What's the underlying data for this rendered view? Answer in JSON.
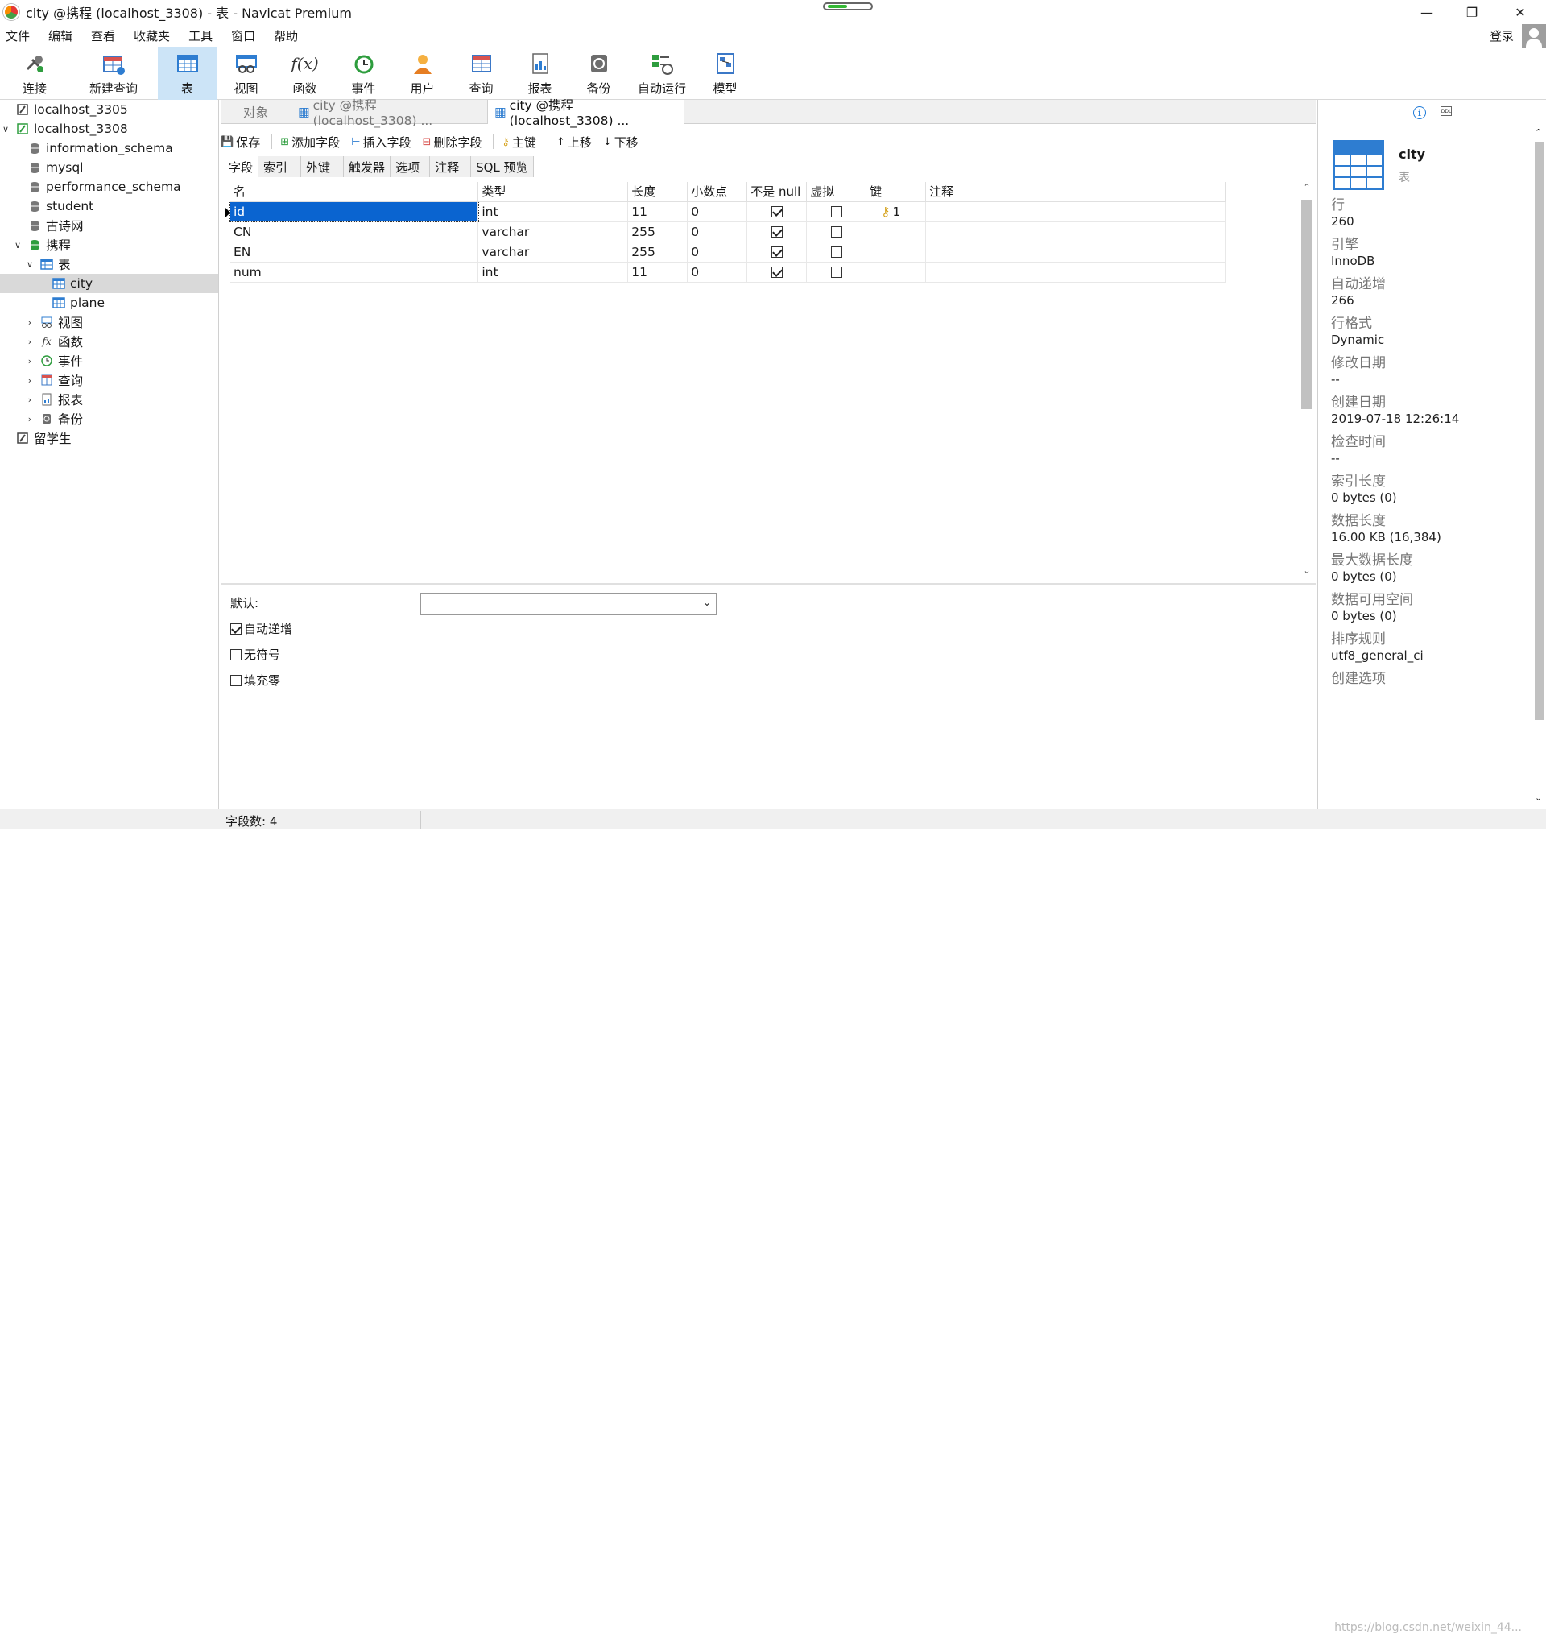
{
  "window": {
    "title": "city @携程 (localhost_3308) - 表 - Navicat Premium"
  },
  "menu": [
    "文件",
    "编辑",
    "查看",
    "收藏夹",
    "工具",
    "窗口",
    "帮助"
  ],
  "login_label": "登录",
  "toolbar": [
    {
      "label": "连接",
      "icon": "connect-icon"
    },
    {
      "label": "新建查询",
      "icon": "new-query-icon"
    },
    {
      "label": "表",
      "icon": "table-icon",
      "active": true
    },
    {
      "label": "视图",
      "icon": "view-icon"
    },
    {
      "label": "函数",
      "icon": "function-icon"
    },
    {
      "label": "事件",
      "icon": "event-icon"
    },
    {
      "label": "用户",
      "icon": "user-icon"
    },
    {
      "label": "查询",
      "icon": "query-icon"
    },
    {
      "label": "报表",
      "icon": "report-icon"
    },
    {
      "label": "备份",
      "icon": "backup-icon"
    },
    {
      "label": "自动运行",
      "icon": "autorun-icon"
    },
    {
      "label": "模型",
      "icon": "model-icon"
    }
  ],
  "tree": [
    {
      "label": "localhost_3305",
      "level": 0,
      "arrow": "",
      "icon": "conn"
    },
    {
      "label": "localhost_3308",
      "level": 0,
      "arrow": "open",
      "icon": "conn-green"
    },
    {
      "label": "information_schema",
      "level": 1,
      "arrow": "",
      "icon": "db"
    },
    {
      "label": "mysql",
      "level": 1,
      "arrow": "",
      "icon": "db"
    },
    {
      "label": "performance_schema",
      "level": 1,
      "arrow": "",
      "icon": "db"
    },
    {
      "label": "student",
      "level": 1,
      "arrow": "",
      "icon": "db"
    },
    {
      "label": "古诗网",
      "level": 1,
      "arrow": "",
      "icon": "db"
    },
    {
      "label": "携程",
      "level": 1,
      "arrow": "open",
      "icon": "db-green"
    },
    {
      "label": "表",
      "level": 2,
      "arrow": "open",
      "icon": "tables"
    },
    {
      "label": "city",
      "level": 3,
      "arrow": "",
      "icon": "table",
      "selected": true
    },
    {
      "label": "plane",
      "level": 3,
      "arrow": "",
      "icon": "table"
    },
    {
      "label": "视图",
      "level": 2,
      "arrow": "closed",
      "icon": "view"
    },
    {
      "label": "函数",
      "level": 2,
      "arrow": "closed",
      "icon": "func"
    },
    {
      "label": "事件",
      "level": 2,
      "arrow": "closed",
      "icon": "event"
    },
    {
      "label": "查询",
      "level": 2,
      "arrow": "closed",
      "icon": "query"
    },
    {
      "label": "报表",
      "level": 2,
      "arrow": "closed",
      "icon": "report"
    },
    {
      "label": "备份",
      "level": 2,
      "arrow": "closed",
      "icon": "backup"
    },
    {
      "label": "留学生",
      "level": 0,
      "arrow": "",
      "icon": "conn"
    }
  ],
  "tabs": [
    {
      "label": "对象",
      "active": false
    },
    {
      "label": "city @携程 (localhost_3308) ...",
      "active": false
    },
    {
      "label": "city @携程 (localhost_3308) ...",
      "active": true
    }
  ],
  "subtoolbar": [
    "保存",
    "添加字段",
    "插入字段",
    "删除字段",
    "主键",
    "上移",
    "下移"
  ],
  "inner_tabs": [
    "字段",
    "索引",
    "外键",
    "触发器",
    "选项",
    "注释",
    "SQL 预览"
  ],
  "grid": {
    "columns": [
      "名",
      "类型",
      "长度",
      "小数点",
      "不是 null",
      "虚拟",
      "键",
      "注释"
    ],
    "rows": [
      {
        "name": "id",
        "type": "int",
        "length": "11",
        "decimals": "0",
        "notnull": true,
        "virtual": false,
        "key": "1",
        "comment": ""
      },
      {
        "name": "CN",
        "type": "varchar",
        "length": "255",
        "decimals": "0",
        "notnull": true,
        "virtual": false,
        "key": "",
        "comment": ""
      },
      {
        "name": "EN",
        "type": "varchar",
        "length": "255",
        "decimals": "0",
        "notnull": true,
        "virtual": false,
        "key": "",
        "comment": ""
      },
      {
        "name": "num",
        "type": "int",
        "length": "11",
        "decimals": "0",
        "notnull": true,
        "virtual": false,
        "key": "",
        "comment": ""
      }
    ]
  },
  "field_props": {
    "default_label": "默认:",
    "default_value": "",
    "options": [
      {
        "label": "自动递增",
        "checked": true
      },
      {
        "label": "无符号",
        "checked": false
      },
      {
        "label": "填充零",
        "checked": false
      }
    ]
  },
  "status": {
    "field_count": "字段数: 4"
  },
  "info": {
    "name": "city",
    "type": "表",
    "props": [
      {
        "k": "行",
        "v": "260"
      },
      {
        "k": "引擎",
        "v": "InnoDB"
      },
      {
        "k": "自动递增",
        "v": "266"
      },
      {
        "k": "行格式",
        "v": "Dynamic"
      },
      {
        "k": "修改日期",
        "v": "--"
      },
      {
        "k": "创建日期",
        "v": "2019-07-18 12:26:14"
      },
      {
        "k": "检查时间",
        "v": "--"
      },
      {
        "k": "索引长度",
        "v": "0 bytes (0)"
      },
      {
        "k": "数据长度",
        "v": "16.00 KB (16,384)"
      },
      {
        "k": "最大数据长度",
        "v": "0 bytes (0)"
      },
      {
        "k": "数据可用空间",
        "v": "0 bytes (0)"
      },
      {
        "k": "排序规则",
        "v": "utf8_general_ci"
      },
      {
        "k": "创建选项",
        "v": ""
      }
    ]
  },
  "watermark": "https://blog.csdn.net/weixin_44..."
}
